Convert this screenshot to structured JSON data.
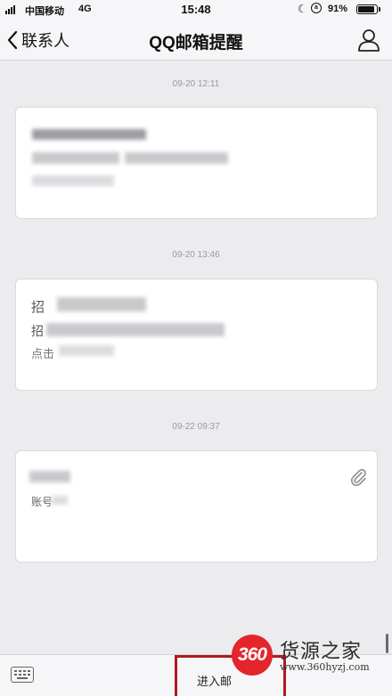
{
  "status_bar": {
    "carrier": "中国移动",
    "network": "4G",
    "time": "15:48",
    "battery": "91%",
    "battery_level": 0.91,
    "icons": [
      "signal-icon",
      "moon-icon",
      "rotation-lock-icon",
      "battery-icon"
    ]
  },
  "nav": {
    "back_label": "联系人",
    "title": "QQ邮箱提醒",
    "back_icon": "chevron-left-icon",
    "profile_icon": "person-icon"
  },
  "messages": [
    {
      "time": "09-20 12:11",
      "lines": []
    },
    {
      "time": "09-20 13:46",
      "lines": [
        "招",
        "招",
        "点击"
      ]
    },
    {
      "time": "09-22 09:37",
      "lines": [
        "账号"
      ],
      "attachment_icon": "paperclip-icon"
    }
  ],
  "bottom_bar": {
    "keyboard_icon": "keyboard-icon",
    "menu_label": "进入邮"
  },
  "watermark": {
    "badge": "360",
    "name": "货源之家",
    "url": "www.360hyzj.com"
  },
  "colors": {
    "background": "#ececef",
    "bar": "#f6f6f8",
    "highlight_border": "#b0191e",
    "watermark_red": "#e4252c"
  }
}
